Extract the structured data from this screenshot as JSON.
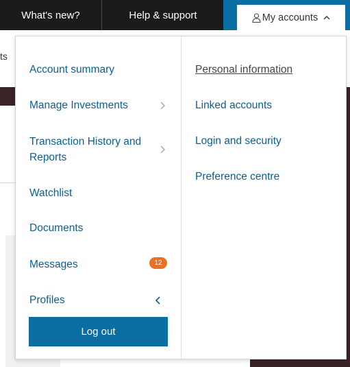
{
  "topbar": {
    "whats_new": "What's new?",
    "help_support": "Help & support",
    "my_accounts": "My accounts"
  },
  "background": {
    "partial_text": "ts"
  },
  "menu": {
    "left": [
      {
        "label": "Account summary"
      },
      {
        "label": "Manage Investments"
      },
      {
        "label_line1": "Transaction History and",
        "label_line2": "Reports"
      },
      {
        "label": "Watchlist"
      },
      {
        "label": "Documents"
      },
      {
        "label": "Messages",
        "badge": "12"
      },
      {
        "label": "Profiles"
      }
    ],
    "right": [
      {
        "label": "Personal information",
        "active": true
      },
      {
        "label": "Linked accounts"
      },
      {
        "label": "Login and security"
      },
      {
        "label": "Preference centre"
      }
    ],
    "logout_label": "Log out"
  },
  "colors": {
    "topbar_bg": "#1b1b1b",
    "accent_blue": "#0b6ea3",
    "link_blue": "#0a5f8f",
    "badge_orange": "#e8702a",
    "dark_maroon": "#3a2226"
  }
}
